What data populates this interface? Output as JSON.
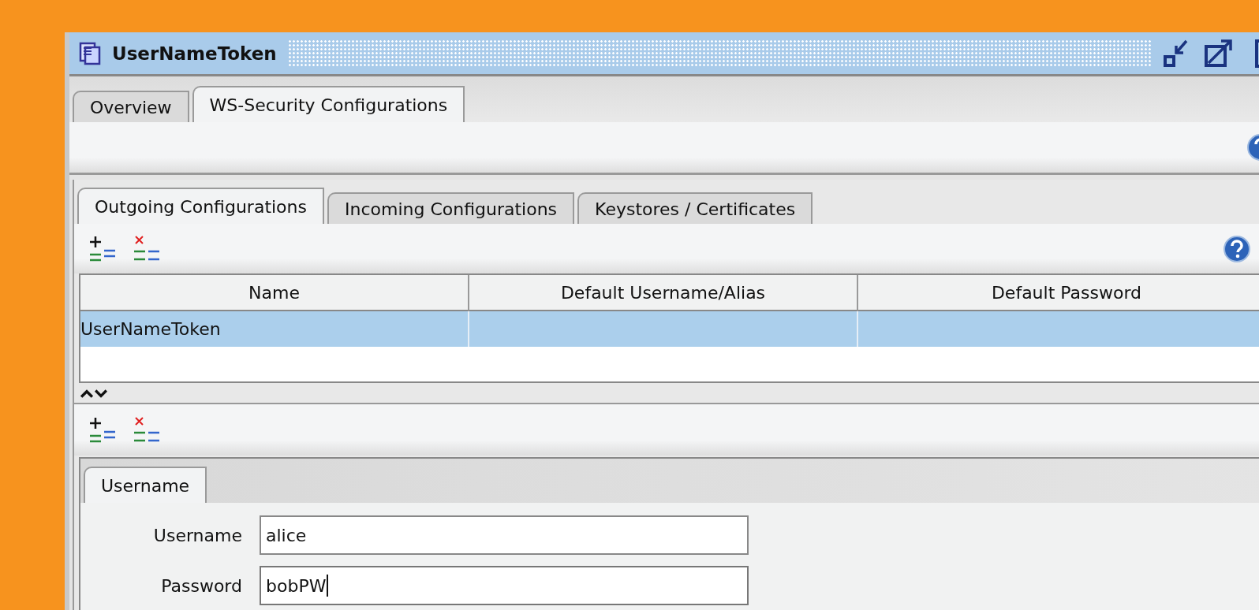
{
  "window": {
    "title": "UserNameToken"
  },
  "tabs": [
    {
      "label": "Overview",
      "selected": false
    },
    {
      "label": "WS-Security Configurations",
      "selected": true
    }
  ],
  "config_tabs": [
    {
      "label": "Outgoing Configurations",
      "selected": true
    },
    {
      "label": "Incoming Configurations",
      "selected": false
    },
    {
      "label": "Keystores / Certificates",
      "selected": false
    }
  ],
  "table": {
    "columns": [
      "Name",
      "Default Username/Alias",
      "Default Password"
    ],
    "rows": [
      {
        "name": "UserNameToken",
        "selected": true
      }
    ]
  },
  "detail_tabs": [
    {
      "label": "Username",
      "selected": true
    }
  ],
  "form": [
    {
      "label": "Username",
      "value": "alice",
      "focused": false
    },
    {
      "label": "Password",
      "value": "bobPW",
      "focused": true
    }
  ]
}
